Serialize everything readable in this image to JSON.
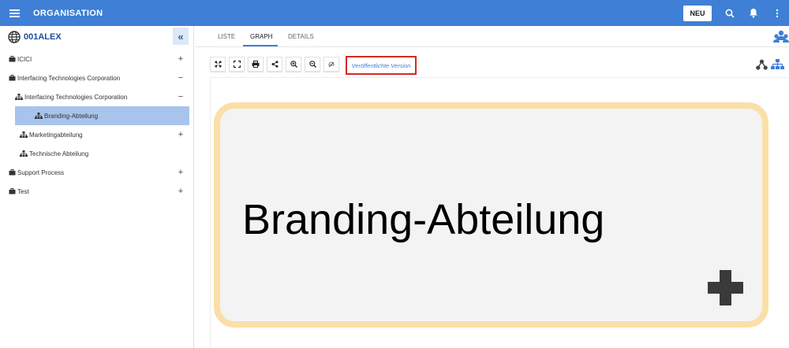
{
  "app": {
    "title": "ORGANISATION"
  },
  "topbar": {
    "new_label": "NEU",
    "icons": [
      "menu-icon",
      "search-icon",
      "bell-icon",
      "more-vert-icon"
    ]
  },
  "sidebar": {
    "title": "001ALEX",
    "items": [
      {
        "label": "ICICI",
        "toggle": "+",
        "icon": "briefcase-icon"
      },
      {
        "label": "Interfacing Technologies Corporation",
        "toggle": "−",
        "icon": "briefcase-icon"
      },
      {
        "label": "Interfacing Technologies Corporation",
        "toggle": "−",
        "icon": "org-chart-icon"
      },
      {
        "label": "Branding-Abteilung",
        "toggle": "",
        "icon": "org-chart-icon",
        "selected": true
      },
      {
        "label": "Marketingabteilung",
        "toggle": "+",
        "icon": "org-chart-icon"
      },
      {
        "label": "Technische Abteilung",
        "toggle": "",
        "icon": "org-chart-icon"
      },
      {
        "label": "Support Process",
        "toggle": "+",
        "icon": "briefcase-icon"
      },
      {
        "label": "Test",
        "toggle": "+",
        "icon": "briefcase-icon"
      }
    ]
  },
  "main": {
    "tabs": [
      {
        "label": "LISTE"
      },
      {
        "label": "GRAPH",
        "active": true
      },
      {
        "label": "DETAILS"
      }
    ],
    "toolbar": {
      "buttons": [
        "fit-screen-icon",
        "fullscreen-icon",
        "print-icon",
        "share-icon",
        "zoom-in-icon",
        "zoom-out-icon",
        "hide-icon"
      ]
    },
    "version_label": "Veröffentlichte Version",
    "node": {
      "label": "Branding-Abteilung"
    }
  },
  "colors": {
    "accent": "#3f7fd6",
    "selected": "#a8c4ec",
    "node_border": "#fbdfa8",
    "node_fill": "#f3f3f3",
    "highlight": "#d62828"
  }
}
